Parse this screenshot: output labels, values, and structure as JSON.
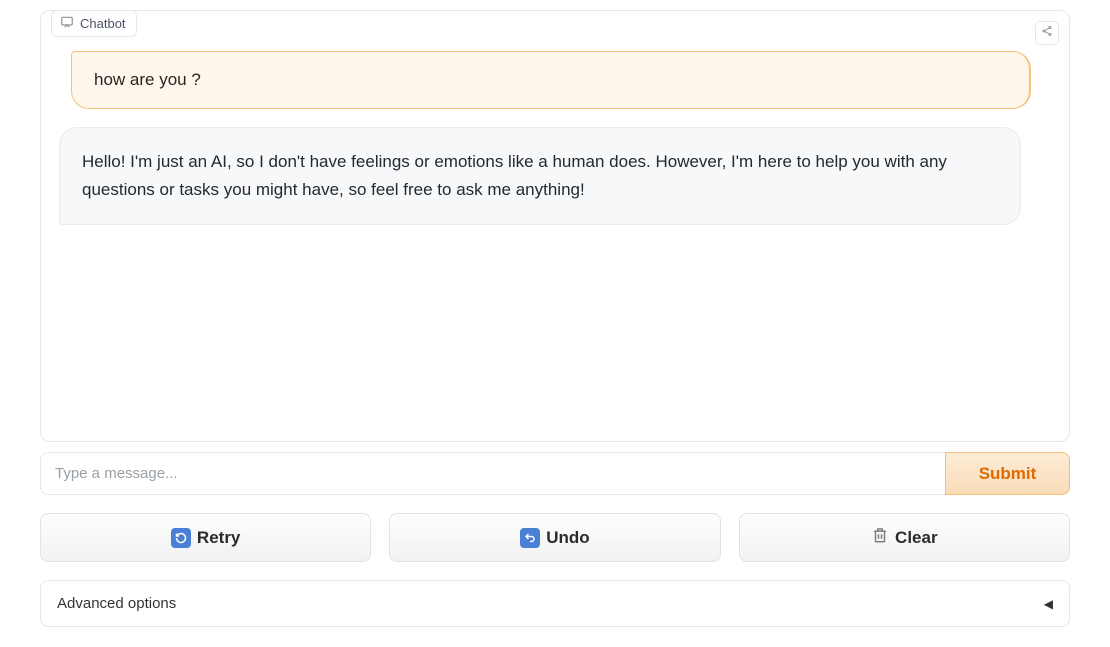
{
  "panel": {
    "title": "Chatbot"
  },
  "chat": {
    "user_message": "how are you ?",
    "bot_message": "Hello! I'm just an AI, so I don't have feelings or emotions like a human does. However, I'm here to help you with any questions or tasks you might have, so feel free to ask me anything!"
  },
  "input": {
    "placeholder": "Type a message...",
    "value": "",
    "submit_label": "Submit"
  },
  "actions": {
    "retry_label": "Retry",
    "undo_label": "Undo",
    "clear_label": "Clear"
  },
  "advanced": {
    "label": "Advanced options"
  }
}
